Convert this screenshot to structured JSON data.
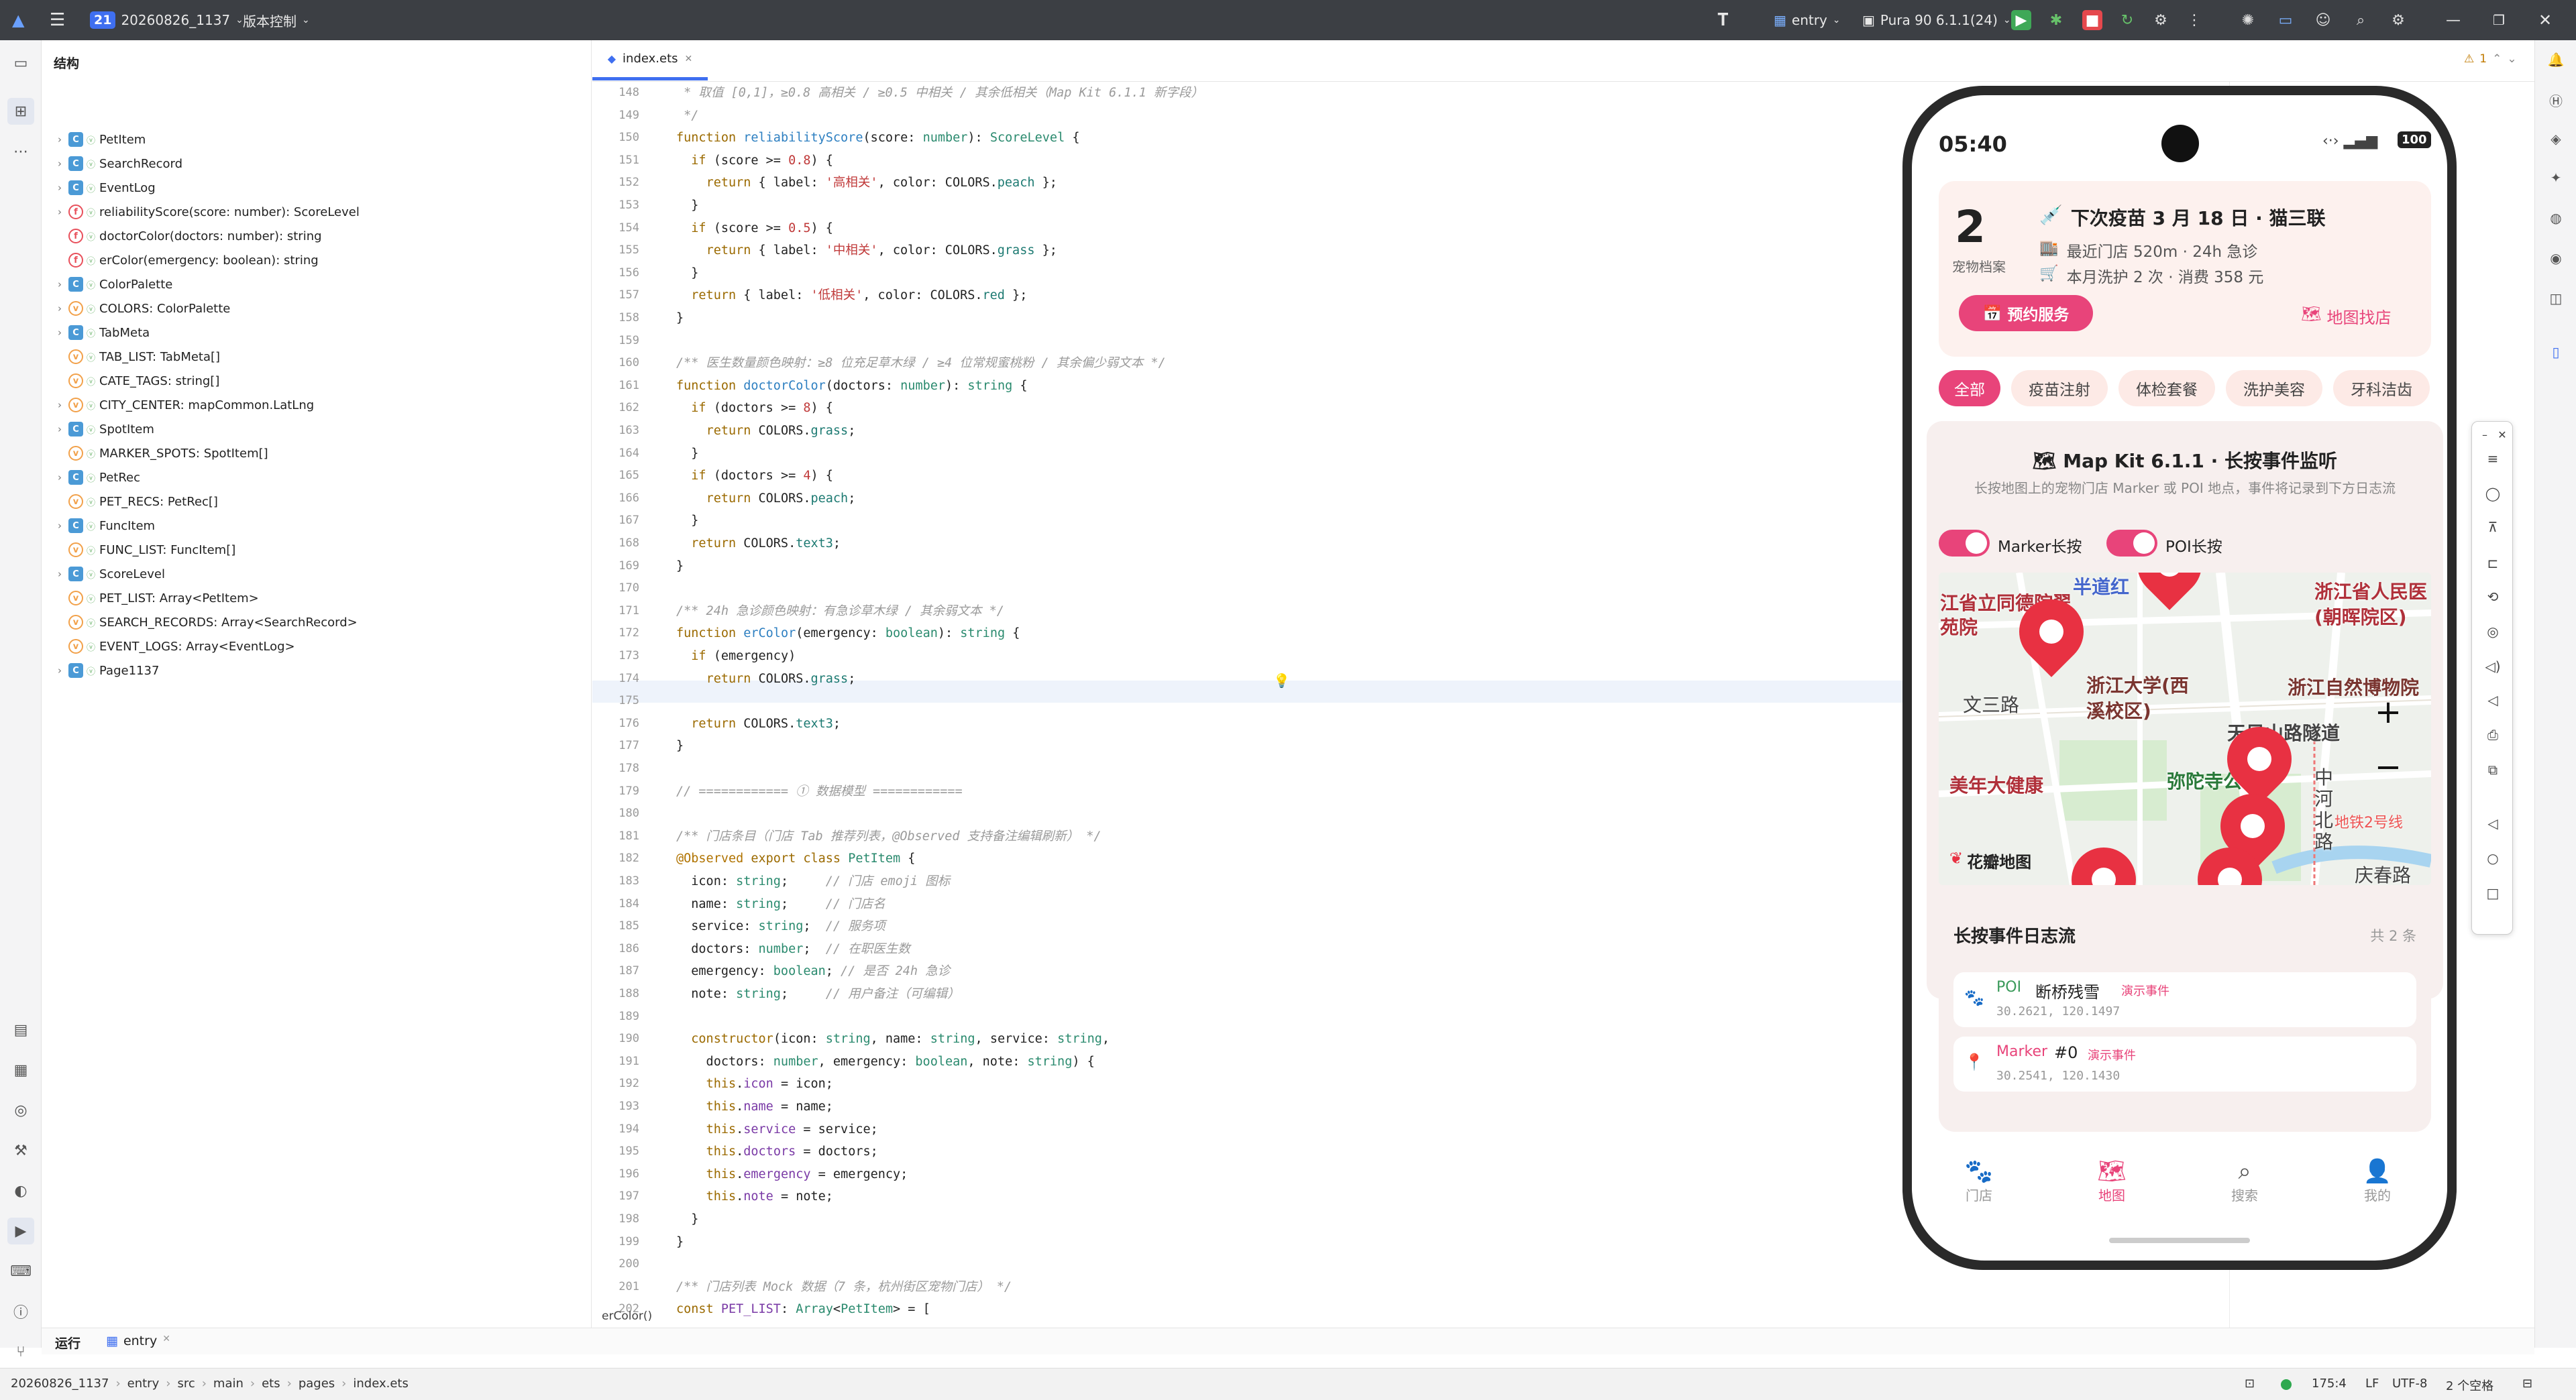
{
  "titlebar": {
    "project_badge": "21",
    "project_name": "20260826_1137",
    "vcs": "版本控制",
    "module": "entry",
    "device": "Pura 90 6.1.1(24)"
  },
  "structure": {
    "title": "结构",
    "items": [
      {
        "label": "PetItem",
        "kind": "class",
        "expand": true
      },
      {
        "label": "SearchRecord",
        "kind": "class",
        "expand": true
      },
      {
        "label": "EventLog",
        "kind": "class",
        "expand": true
      },
      {
        "label": "reliabilityScore(score: number): ScoreLevel",
        "kind": "func",
        "expand": true
      },
      {
        "label": "doctorColor(doctors: number): string",
        "kind": "func",
        "expand": false
      },
      {
        "label": "erColor(emergency: boolean): string",
        "kind": "func",
        "expand": false
      },
      {
        "label": "ColorPalette",
        "kind": "class",
        "expand": true
      },
      {
        "label": "COLORS: ColorPalette",
        "kind": "var",
        "expand": true
      },
      {
        "label": "TabMeta",
        "kind": "class",
        "expand": true
      },
      {
        "label": "TAB_LIST: TabMeta[]",
        "kind": "var",
        "expand": false
      },
      {
        "label": "CATE_TAGS: string[]",
        "kind": "var",
        "expand": false
      },
      {
        "label": "CITY_CENTER: mapCommon.LatLng",
        "kind": "var",
        "expand": true
      },
      {
        "label": "SpotItem",
        "kind": "class",
        "expand": true
      },
      {
        "label": "MARKER_SPOTS: SpotItem[]",
        "kind": "var",
        "expand": false
      },
      {
        "label": "PetRec",
        "kind": "class",
        "expand": true
      },
      {
        "label": "PET_RECS: PetRec[]",
        "kind": "var",
        "expand": false
      },
      {
        "label": "FuncItem",
        "kind": "class",
        "expand": true
      },
      {
        "label": "FUNC_LIST: FuncItem[]",
        "kind": "var",
        "expand": false
      },
      {
        "label": "ScoreLevel",
        "kind": "class",
        "expand": true
      },
      {
        "label": "PET_LIST: Array<PetItem>",
        "kind": "var",
        "expand": false
      },
      {
        "label": "SEARCH_RECORDS: Array<SearchRecord>",
        "kind": "var",
        "expand": false
      },
      {
        "label": "EVENT_LOGS: Array<EventLog>",
        "kind": "var",
        "expand": false
      },
      {
        "label": "Page1137",
        "kind": "class",
        "expand": true
      }
    ]
  },
  "editor": {
    "tab_label": "index.ets",
    "warning_count": "1",
    "breadcrumb": "erColor()",
    "line_numbers": [
      "148",
      "149",
      "150",
      "151",
      "152",
      "153",
      "154",
      "155",
      "156",
      "157",
      "158",
      "159",
      "160",
      "161",
      "162",
      "163",
      "164",
      "165",
      "166",
      "167",
      "168",
      "169",
      "170",
      "171",
      "172",
      "173",
      "174",
      "175",
      "176",
      "177",
      "178",
      "179",
      "180",
      "181",
      "182",
      "183",
      "184",
      "185",
      "186",
      "187",
      "188",
      "189",
      "190",
      "191",
      "192",
      "193",
      "194",
      "195",
      "196",
      "197",
      "198",
      "199",
      "200",
      "201",
      "202"
    ],
    "code_lines": [
      [
        {
          "t": " * 取值 [0,1]，≥0.8 高相关 / ≥0.5 中相关 / 其余低相关（Map Kit 6.1.1 新字段）",
          "c": "cm"
        }
      ],
      [
        {
          "t": " */",
          "c": "cm"
        }
      ],
      [
        {
          "t": "function ",
          "c": "kw"
        },
        {
          "t": "reliabilityScore",
          "c": "fn"
        },
        {
          "t": "(score: "
        },
        {
          "t": "number",
          "c": "ty"
        },
        {
          "t": "): "
        },
        {
          "t": "ScoreLevel",
          "c": "ty"
        },
        {
          "t": " {"
        }
      ],
      [
        {
          "t": "  "
        },
        {
          "t": "if",
          "c": "kw"
        },
        {
          "t": " (score >= "
        },
        {
          "t": "0.8",
          "c": "num"
        },
        {
          "t": ") {"
        }
      ],
      [
        {
          "t": "    "
        },
        {
          "t": "return",
          "c": "kw"
        },
        {
          "t": " { label: "
        },
        {
          "t": "'高相关'",
          "c": "str"
        },
        {
          "t": ", color: COLORS."
        },
        {
          "t": "peach",
          "c": "kw2"
        },
        {
          "t": " };"
        }
      ],
      [
        {
          "t": "  }"
        }
      ],
      [
        {
          "t": "  "
        },
        {
          "t": "if",
          "c": "kw"
        },
        {
          "t": " (score >= "
        },
        {
          "t": "0.5",
          "c": "num"
        },
        {
          "t": ") {"
        }
      ],
      [
        {
          "t": "    "
        },
        {
          "t": "return",
          "c": "kw"
        },
        {
          "t": " { label: "
        },
        {
          "t": "'中相关'",
          "c": "str"
        },
        {
          "t": ", color: COLORS."
        },
        {
          "t": "grass",
          "c": "kw2"
        },
        {
          "t": " };"
        }
      ],
      [
        {
          "t": "  }"
        }
      ],
      [
        {
          "t": "  "
        },
        {
          "t": "return",
          "c": "kw"
        },
        {
          "t": " { label: "
        },
        {
          "t": "'低相关'",
          "c": "str"
        },
        {
          "t": ", color: COLORS."
        },
        {
          "t": "red",
          "c": "kw2"
        },
        {
          "t": " };"
        }
      ],
      [
        {
          "t": "}"
        }
      ],
      [
        {
          "t": ""
        }
      ],
      [
        {
          "t": "/** 医生数量颜色映射：≥8 位充足草木绿 / ≥4 位常规蜜桃粉 / 其余偏少弱文本 */",
          "c": "cm"
        }
      ],
      [
        {
          "t": "function ",
          "c": "kw"
        },
        {
          "t": "doctorColor",
          "c": "fn"
        },
        {
          "t": "(doctors: "
        },
        {
          "t": "number",
          "c": "ty"
        },
        {
          "t": "): "
        },
        {
          "t": "string",
          "c": "ty"
        },
        {
          "t": " {"
        }
      ],
      [
        {
          "t": "  "
        },
        {
          "t": "if",
          "c": "kw"
        },
        {
          "t": " (doctors >= "
        },
        {
          "t": "8",
          "c": "num"
        },
        {
          "t": ") {"
        }
      ],
      [
        {
          "t": "    "
        },
        {
          "t": "return",
          "c": "kw"
        },
        {
          "t": " COLORS."
        },
        {
          "t": "grass",
          "c": "kw2"
        },
        {
          "t": ";"
        }
      ],
      [
        {
          "t": "  }"
        }
      ],
      [
        {
          "t": "  "
        },
        {
          "t": "if",
          "c": "kw"
        },
        {
          "t": " (doctors >= "
        },
        {
          "t": "4",
          "c": "num"
        },
        {
          "t": ") {"
        }
      ],
      [
        {
          "t": "    "
        },
        {
          "t": "return",
          "c": "kw"
        },
        {
          "t": " COLORS."
        },
        {
          "t": "peach",
          "c": "kw2"
        },
        {
          "t": ";"
        }
      ],
      [
        {
          "t": "  }"
        }
      ],
      [
        {
          "t": "  "
        },
        {
          "t": "return",
          "c": "kw"
        },
        {
          "t": " COLORS."
        },
        {
          "t": "text3",
          "c": "kw2"
        },
        {
          "t": ";"
        }
      ],
      [
        {
          "t": "}"
        }
      ],
      [
        {
          "t": ""
        }
      ],
      [
        {
          "t": "/** 24h 急诊颜色映射：有急诊草木绿 / 其余弱文本 */",
          "c": "cm"
        }
      ],
      [
        {
          "t": "function ",
          "c": "kw"
        },
        {
          "t": "erColor",
          "c": "fn"
        },
        {
          "t": "(emergency: "
        },
        {
          "t": "boolean",
          "c": "ty"
        },
        {
          "t": "): "
        },
        {
          "t": "string",
          "c": "ty"
        },
        {
          "t": " {"
        }
      ],
      [
        {
          "t": "  "
        },
        {
          "t": "if",
          "c": "kw"
        },
        {
          "t": " (emergency) "
        }
      ],
      [
        {
          "t": "    "
        },
        {
          "t": "return",
          "c": "kw"
        },
        {
          "t": " COLORS."
        },
        {
          "t": "grass",
          "c": "kw2"
        },
        {
          "t": ";"
        }
      ],
      [
        {
          "t": "  "
        }
      ],
      [
        {
          "t": "  "
        },
        {
          "t": "return",
          "c": "kw"
        },
        {
          "t": " COLORS."
        },
        {
          "t": "text3",
          "c": "kw2"
        },
        {
          "t": ";"
        }
      ],
      [
        {
          "t": "}"
        }
      ],
      [
        {
          "t": ""
        }
      ],
      [
        {
          "t": "// ============ ① 数据模型 ============",
          "c": "cm"
        }
      ],
      [
        {
          "t": ""
        }
      ],
      [
        {
          "t": "/** 门店条目（门店 Tab 推荐列表，@Observed 支持备注编辑刷新） */",
          "c": "cm"
        }
      ],
      [
        {
          "t": "@Observed ",
          "c": "dec"
        },
        {
          "t": "export class ",
          "c": "kw"
        },
        {
          "t": "PetItem",
          "c": "ty"
        },
        {
          "t": " {"
        }
      ],
      [
        {
          "t": "  icon: "
        },
        {
          "t": "string",
          "c": "ty"
        },
        {
          "t": ";     "
        },
        {
          "t": "// 门店 emoji 图标",
          "c": "cm"
        }
      ],
      [
        {
          "t": "  name: "
        },
        {
          "t": "string",
          "c": "ty"
        },
        {
          "t": ";     "
        },
        {
          "t": "// 门店名",
          "c": "cm"
        }
      ],
      [
        {
          "t": "  service: "
        },
        {
          "t": "string",
          "c": "ty"
        },
        {
          "t": ";  "
        },
        {
          "t": "// 服务项",
          "c": "cm"
        }
      ],
      [
        {
          "t": "  doctors: "
        },
        {
          "t": "number",
          "c": "ty"
        },
        {
          "t": ";  "
        },
        {
          "t": "// 在职医生数",
          "c": "cm"
        }
      ],
      [
        {
          "t": "  emergency: "
        },
        {
          "t": "boolean",
          "c": "ty"
        },
        {
          "t": "; "
        },
        {
          "t": "// 是否 24h 急诊",
          "c": "cm"
        }
      ],
      [
        {
          "t": "  note: "
        },
        {
          "t": "string",
          "c": "ty"
        },
        {
          "t": ";     "
        },
        {
          "t": "// 用户备注（可编辑）",
          "c": "cm"
        }
      ],
      [
        {
          "t": ""
        }
      ],
      [
        {
          "t": "  "
        },
        {
          "t": "constructor",
          "c": "kw"
        },
        {
          "t": "(icon: "
        },
        {
          "t": "string",
          "c": "ty"
        },
        {
          "t": ", name: "
        },
        {
          "t": "string",
          "c": "ty"
        },
        {
          "t": ", service: "
        },
        {
          "t": "string",
          "c": "ty"
        },
        {
          "t": ","
        }
      ],
      [
        {
          "t": "    doctors: "
        },
        {
          "t": "number",
          "c": "ty"
        },
        {
          "t": ", emergency: "
        },
        {
          "t": "boolean",
          "c": "ty"
        },
        {
          "t": ", note: "
        },
        {
          "t": "string",
          "c": "ty"
        },
        {
          "t": ") {"
        }
      ],
      [
        {
          "t": "    "
        },
        {
          "t": "this",
          "c": "kw"
        },
        {
          "t": "."
        },
        {
          "t": "icon",
          "c": "ob"
        },
        {
          "t": " = icon;"
        }
      ],
      [
        {
          "t": "    "
        },
        {
          "t": "this",
          "c": "kw"
        },
        {
          "t": "."
        },
        {
          "t": "name",
          "c": "ob"
        },
        {
          "t": " = name;"
        }
      ],
      [
        {
          "t": "    "
        },
        {
          "t": "this",
          "c": "kw"
        },
        {
          "t": "."
        },
        {
          "t": "service",
          "c": "ob"
        },
        {
          "t": " = service;"
        }
      ],
      [
        {
          "t": "    "
        },
        {
          "t": "this",
          "c": "kw"
        },
        {
          "t": "."
        },
        {
          "t": "doctors",
          "c": "ob"
        },
        {
          "t": " = doctors;"
        }
      ],
      [
        {
          "t": "    "
        },
        {
          "t": "this",
          "c": "kw"
        },
        {
          "t": "."
        },
        {
          "t": "emergency",
          "c": "ob"
        },
        {
          "t": " = emergency;"
        }
      ],
      [
        {
          "t": "    "
        },
        {
          "t": "this",
          "c": "kw"
        },
        {
          "t": "."
        },
        {
          "t": "note",
          "c": "ob"
        },
        {
          "t": " = note;"
        }
      ],
      [
        {
          "t": "  }"
        }
      ],
      [
        {
          "t": "}"
        }
      ],
      [
        {
          "t": ""
        }
      ],
      [
        {
          "t": "/** 门店列表 Mock 数据（7 条，杭州街区宠物门店） */",
          "c": "cm"
        }
      ],
      [
        {
          "t": "const ",
          "c": "kw"
        },
        {
          "t": "PET_LIST",
          "c": "ob"
        },
        {
          "t": ": "
        },
        {
          "t": "Array",
          "c": "ty"
        },
        {
          "t": "<"
        },
        {
          "t": "PetItem",
          "c": "ty"
        },
        {
          "t": "> = ["
        }
      ]
    ]
  },
  "phone": {
    "time": "05:40",
    "battery": "100",
    "summary": {
      "count": "2",
      "count_label": "宠物档案",
      "line1": "下次疫苗 3 月 18 日 · 猫三联",
      "line2": "最近门店 520m · 24h 急诊",
      "line3": "本月洗护 2 次 · 消费 358 元",
      "book_button": "预约服务",
      "map_link": "地图找店"
    },
    "chips": [
      "全部",
      "疫苗注射",
      "体检套餐",
      "洗护美容",
      "牙科洁齿"
    ],
    "listen_card": {
      "title": "Map Kit 6.1.1 · 长按事件监听",
      "subtitle": "长按地图上的宠物门店 Marker 或 POI 地点，事件将记录到下方日志流"
    },
    "toggles": [
      "Marker长按",
      "POI长按"
    ],
    "map": {
      "labels": [
        "江省立同德院翠苑院",
        "浙江大学(西溪校区)",
        "浙江省人民医(朝晖院区)",
        "浙江自然博物院",
        "文三路",
        "美年大健康",
        "弥陀寺公",
        "天目山路隧道",
        "中河北路",
        "地铁2号线",
        "半道红",
        "庆春路"
      ],
      "logo": "花瓣地图",
      "zoom_in": "+",
      "zoom_out": "−"
    },
    "log": {
      "title": "长按事件日志流",
      "count": "共 2 条",
      "entries": [
        {
          "type": "POI",
          "name": "断桥残雪",
          "tag": "演示事件",
          "coords": "30.2621, 120.1497"
        },
        {
          "type": "Marker",
          "name": "#0",
          "tag": "演示事件",
          "coords": "30.2541, 120.1430"
        }
      ]
    },
    "nav": [
      "门店",
      "地图",
      "搜索",
      "我的"
    ]
  },
  "bottom": {
    "run_label": "运行",
    "run_tab": "entry"
  },
  "status": {
    "path": [
      "20260826_1137",
      "entry",
      "src",
      "main",
      "ets",
      "pages",
      "index.ets"
    ],
    "position": "175:4",
    "line_sep": "LF",
    "encoding": "UTF-8",
    "indent": "2 个空格"
  },
  "colors": {
    "accent": "#3f6ff0",
    "phone_primary": "#e8447a",
    "pin": "#e83142"
  }
}
